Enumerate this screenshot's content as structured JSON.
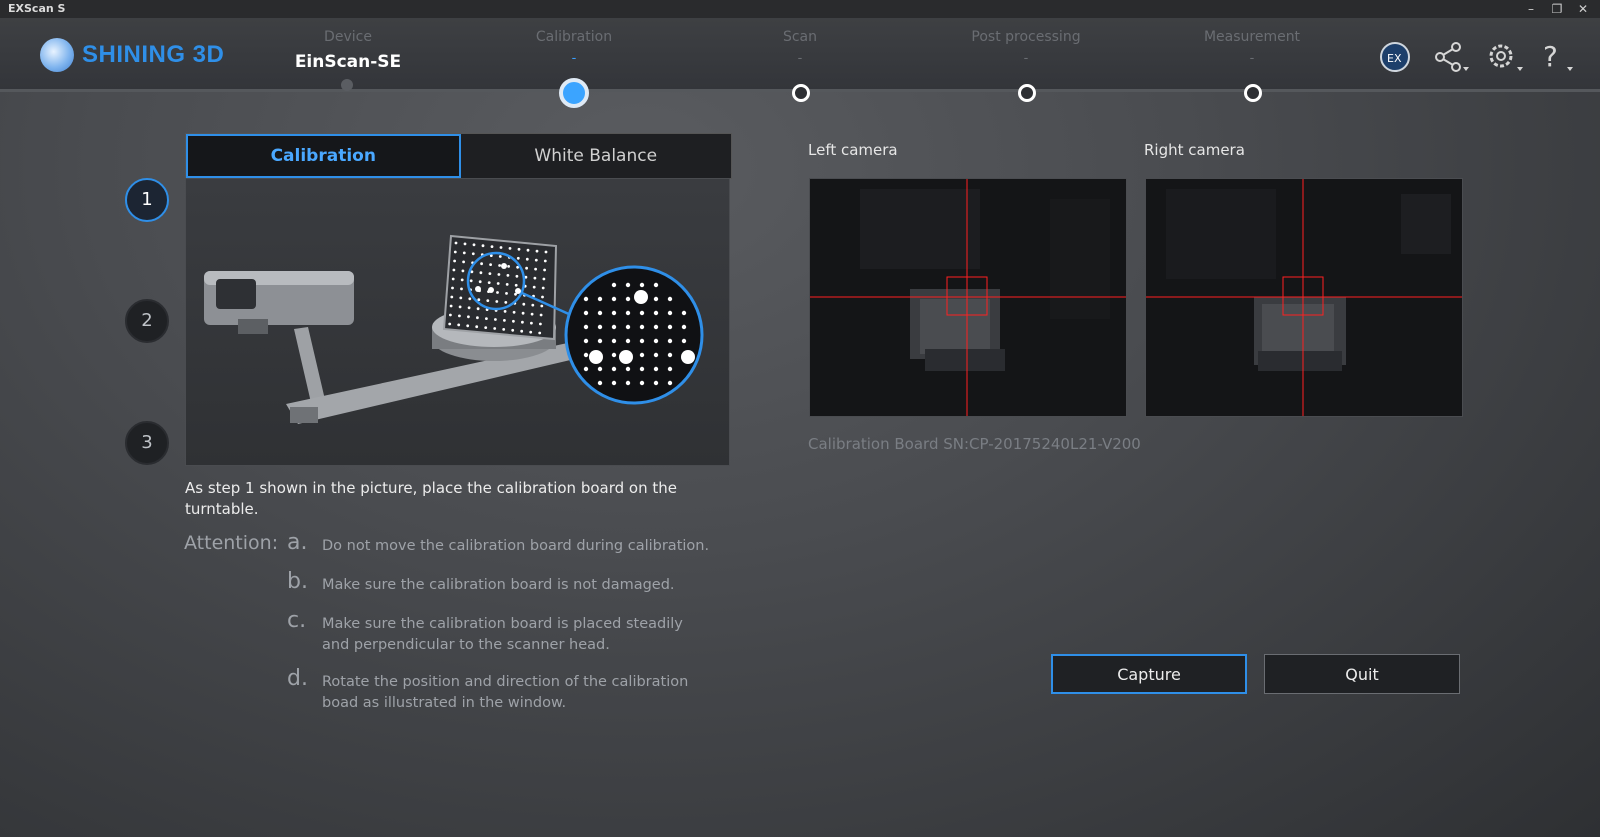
{
  "window": {
    "title": "EXScan S"
  },
  "header": {
    "brand": "SHINING 3D",
    "steps": [
      {
        "label": "Device",
        "value": "EinScan-SE"
      },
      {
        "label": "Calibration",
        "value": "-"
      },
      {
        "label": "Scan",
        "value": "-"
      },
      {
        "label": "Post processing",
        "value": "-"
      },
      {
        "label": "Measurement",
        "value": "-"
      }
    ],
    "icons": [
      "ex-logo-icon",
      "share-icon",
      "settings-icon",
      "help-icon"
    ]
  },
  "left": {
    "step_numbers": [
      "1",
      "2",
      "3"
    ],
    "tabs": [
      {
        "label": "Calibration",
        "active": true
      },
      {
        "label": "White Balance",
        "active": false
      }
    ],
    "description": "As step 1 shown in the picture, place the calibration board on the turntable.",
    "attention_label": "Attention:",
    "attention": [
      {
        "letter": "a.",
        "text": "Do not move the calibration board during calibration."
      },
      {
        "letter": "b.",
        "text": "Make sure the calibration board is not damaged."
      },
      {
        "letter": "c.",
        "text": "Make sure the calibration board is placed steadily and perpendicular to the scanner head."
      },
      {
        "letter": "d.",
        "text": "Rotate the position and direction of the calibration boad as illustrated in the window."
      }
    ]
  },
  "cameras": {
    "left_label": "Left camera",
    "right_label": "Right camera",
    "serial": "Calibration Board SN:CP-20175240L21-V200"
  },
  "actions": {
    "capture": "Capture",
    "quit": "Quit"
  },
  "colors": {
    "accent": "#2f8fe8",
    "crosshair": "#ff2020"
  }
}
